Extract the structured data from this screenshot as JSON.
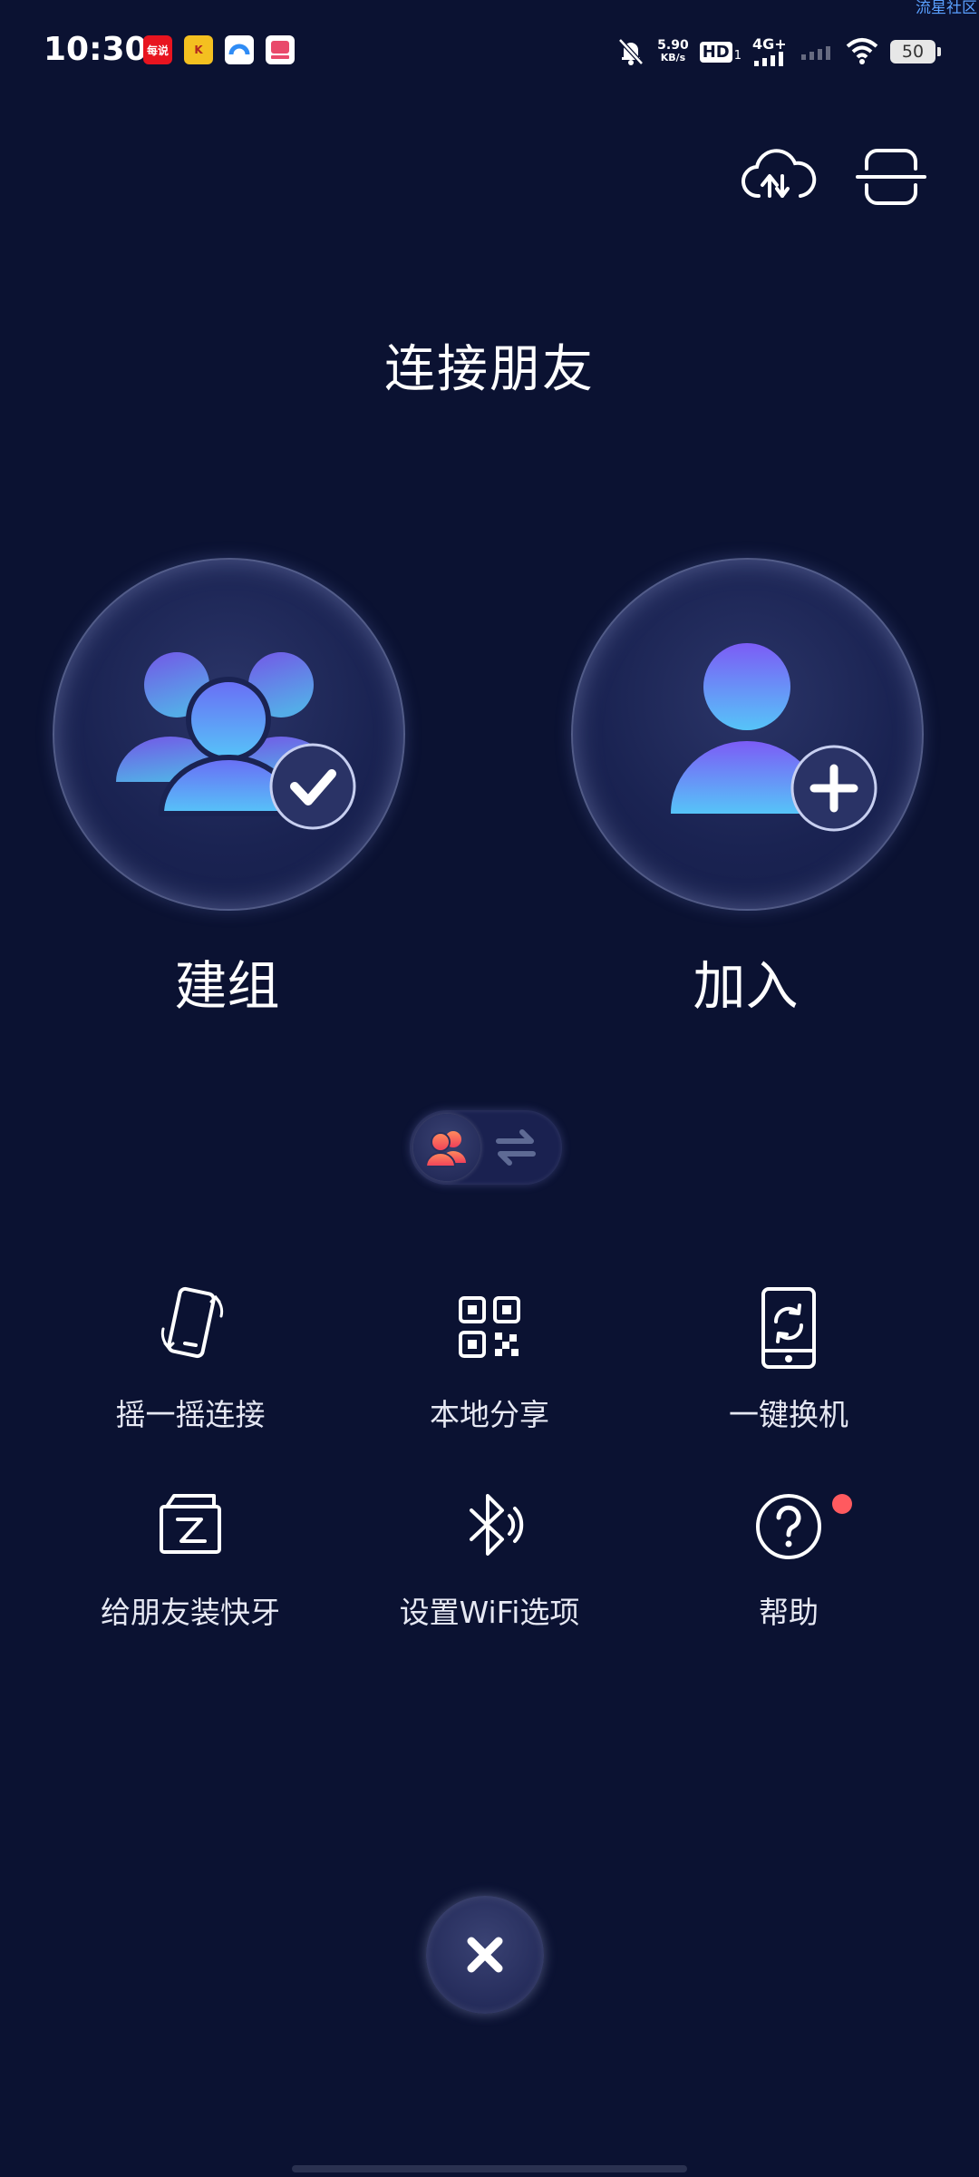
{
  "watermark": "流星社区",
  "status_bar": {
    "time": "10:30",
    "notification_apps": [
      {
        "name": "app1",
        "text": "每说",
        "color": "#e8141f"
      },
      {
        "name": "app2",
        "text": "K",
        "color": "#f4c020"
      },
      {
        "name": "app3",
        "text": "",
        "color": "#2f8cf5"
      },
      {
        "name": "app4",
        "text": "",
        "color": "#e94a6b"
      }
    ],
    "net_speed_value": "5.90",
    "net_speed_unit": "KB/s",
    "hd_label": "HD",
    "hd_sub": "1",
    "network_label": "4G+",
    "battery_level": "50"
  },
  "page_title": "连接朋友",
  "actions": {
    "create_group_label": "建组",
    "join_label": "加入"
  },
  "grid": [
    {
      "label": "摇一摇连接",
      "icon": "shake-phone-icon"
    },
    {
      "label": "本地分享",
      "icon": "qr-code-icon"
    },
    {
      "label": "一键换机",
      "icon": "phone-switch-icon"
    },
    {
      "label": "给朋友装快牙",
      "icon": "install-box-icon"
    },
    {
      "label": "设置WiFi选项",
      "icon": "bluetooth-icon"
    },
    {
      "label": "帮助",
      "icon": "help-icon"
    }
  ],
  "colors": {
    "background": "#0b1232",
    "accent_blue": "#56b7f5",
    "accent_purple": "#7b5cf5",
    "red_dot": "#ff5a5f"
  }
}
